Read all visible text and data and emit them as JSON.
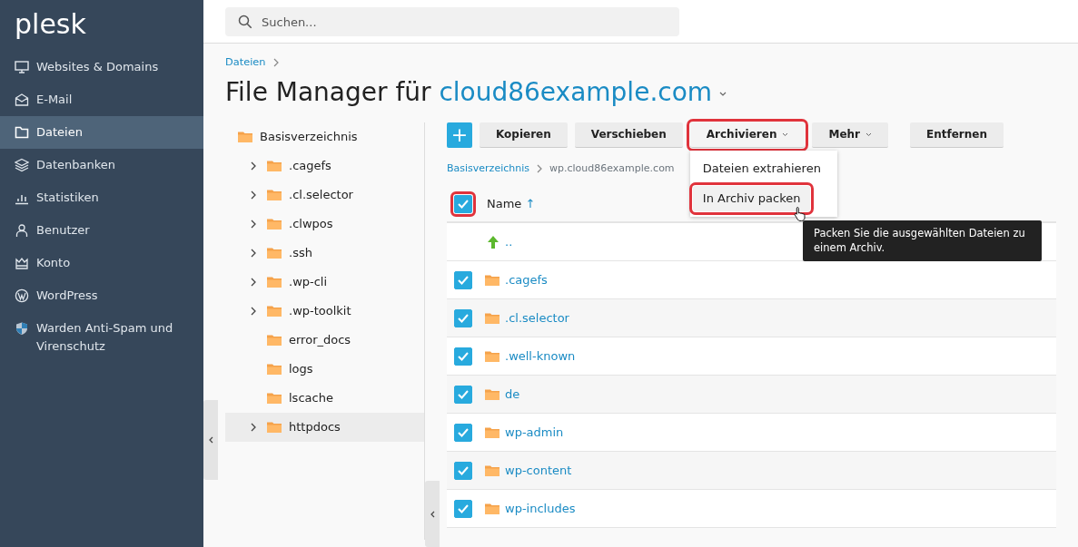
{
  "logo": "plesk",
  "sidebar": {
    "items": [
      {
        "label": "Websites & Domains",
        "selected": false
      },
      {
        "label": "E-Mail",
        "selected": false
      },
      {
        "label": "Dateien",
        "selected": true
      },
      {
        "label": "Datenbanken",
        "selected": false
      },
      {
        "label": "Statistiken",
        "selected": false
      },
      {
        "label": "Benutzer",
        "selected": false
      },
      {
        "label": "Konto",
        "selected": false
      },
      {
        "label": "WordPress",
        "selected": false
      },
      {
        "label": "Warden Anti-Spam und Virenschutz",
        "selected": false
      }
    ]
  },
  "search": {
    "placeholder": "Suchen..."
  },
  "breadcrumb": [
    "Dateien"
  ],
  "title": {
    "text": "File Manager für ",
    "domain": "cloud86example.com"
  },
  "tree": {
    "label": "Basisverzeichnis",
    "children": [
      {
        "label": ".cagefs",
        "expandable": true,
        "selected": false
      },
      {
        "label": ".cl.selector",
        "expandable": true,
        "selected": false
      },
      {
        "label": ".clwpos",
        "expandable": true,
        "selected": false
      },
      {
        "label": ".ssh",
        "expandable": true,
        "selected": false
      },
      {
        "label": ".wp-cli",
        "expandable": true,
        "selected": false
      },
      {
        "label": ".wp-toolkit",
        "expandable": true,
        "selected": false
      },
      {
        "label": "error_docs",
        "expandable": false,
        "selected": false
      },
      {
        "label": "logs",
        "expandable": false,
        "selected": false
      },
      {
        "label": "lscache",
        "expandable": false,
        "selected": false
      },
      {
        "label": "httpdocs",
        "expandable": true,
        "selected": true
      }
    ]
  },
  "toolbar": {
    "add": "+",
    "buttons": [
      {
        "label": "Kopieren",
        "dropdown": false,
        "highlighted": false
      },
      {
        "label": "Verschieben",
        "dropdown": false,
        "highlighted": false
      },
      {
        "label": "Archivieren",
        "dropdown": true,
        "highlighted": true,
        "menu": [
          {
            "label": "Dateien extrahieren",
            "highlighted": false,
            "hovered": false
          },
          {
            "label": "In Archiv packen",
            "highlighted": true,
            "hovered": true
          }
        ]
      },
      {
        "label": "Mehr",
        "dropdown": true,
        "highlighted": false
      },
      {
        "label": "Entfernen",
        "dropdown": false,
        "highlighted": false
      }
    ]
  },
  "tooltip": "Packen Sie die ausgewählten Dateien zu einem Archiv.",
  "path": {
    "root": "Basisverzeichnis",
    "current": "wp.cloud86example.com"
  },
  "table": {
    "select_all": {
      "checked": true,
      "highlighted": true
    },
    "name_column": "Name",
    "sort_arrow": "↑",
    "up_row": "..",
    "rows": [
      {
        "name": ".cagefs",
        "checked": true
      },
      {
        "name": ".cl.selector",
        "checked": true
      },
      {
        "name": ".well-known",
        "checked": true
      },
      {
        "name": "de",
        "checked": true
      },
      {
        "name": "wp-admin",
        "checked": true
      },
      {
        "name": "wp-content",
        "checked": true
      },
      {
        "name": "wp-includes",
        "checked": true
      }
    ]
  }
}
